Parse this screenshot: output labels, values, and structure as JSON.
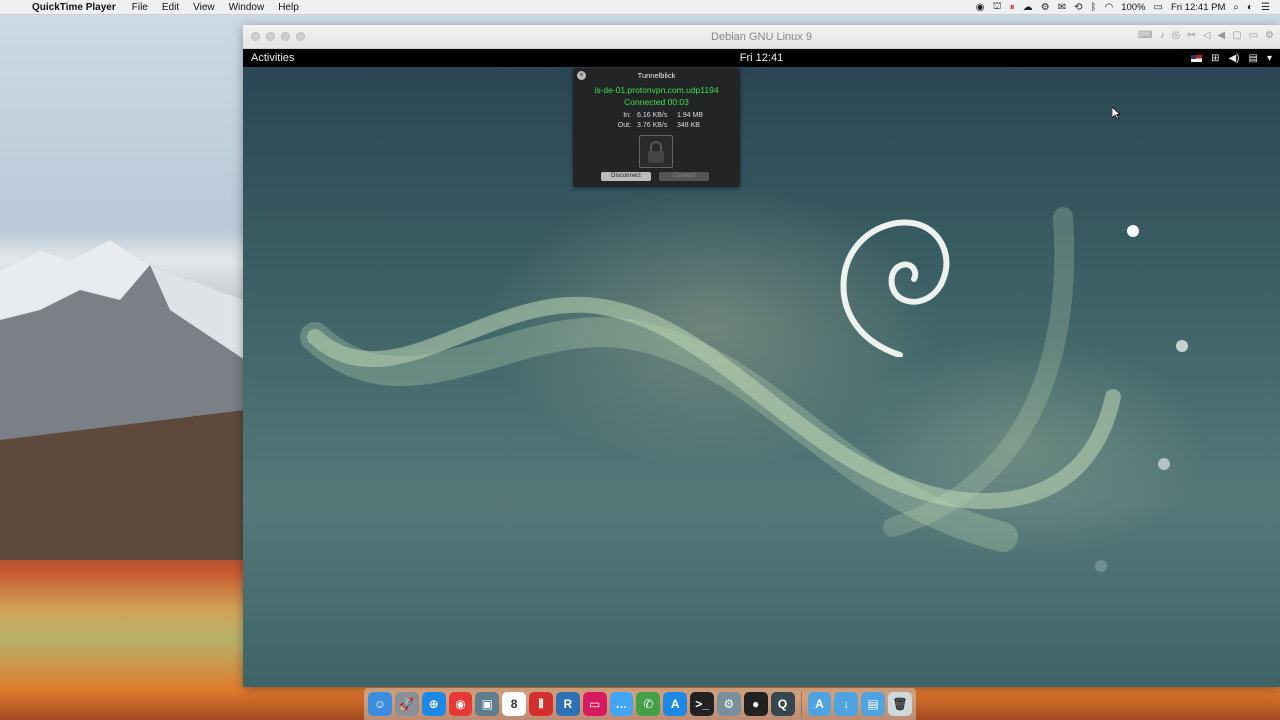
{
  "macos": {
    "menubar": {
      "apple_glyph": "",
      "app_name": "QuickTime Player",
      "menus": [
        "File",
        "Edit",
        "View",
        "Window",
        "Help"
      ],
      "battery": "100%",
      "clock": "Fri 12:41 PM"
    }
  },
  "vm_window": {
    "title": "Debian GNU Linux 9",
    "gnome": {
      "activities": "Activities",
      "clock": "Fri 12:41"
    }
  },
  "tunnelblick": {
    "title": "Tunnelblick",
    "server": "is-de-01.protonvpn.com.udp1194",
    "status": "Connected 00:03",
    "in_label": "In:",
    "in_rate": "6.16 KB/s",
    "in_total": "1.94 MB",
    "out_label": "Out:",
    "out_rate": "3.76 KB/s",
    "out_total": "348 KB",
    "disconnect_label": "Disconnect",
    "connect_label": "Connect"
  },
  "dock": {
    "apps": [
      {
        "name": "finder",
        "glyph": "☺",
        "color": "#3b8de0"
      },
      {
        "name": "launchpad",
        "glyph": "🚀",
        "color": "#8a8f98"
      },
      {
        "name": "safari",
        "glyph": "⊕",
        "color": "#1e88e5"
      },
      {
        "name": "chrome",
        "glyph": "◉",
        "color": "#e53935"
      },
      {
        "name": "preview",
        "glyph": "▣",
        "color": "#607d8b"
      },
      {
        "name": "calendar",
        "glyph": "8",
        "color": "#ffffff"
      },
      {
        "name": "parallels",
        "glyph": "⫴",
        "color": "#d32f2f"
      },
      {
        "name": "r-app",
        "glyph": "R",
        "color": "#2f6fb3"
      },
      {
        "name": "photo-booth",
        "glyph": "▭",
        "color": "#d81b60"
      },
      {
        "name": "messages",
        "glyph": "…",
        "color": "#42a5f5"
      },
      {
        "name": "facetime",
        "glyph": "✆",
        "color": "#43a047"
      },
      {
        "name": "app-store",
        "glyph": "A",
        "color": "#1e88e5"
      },
      {
        "name": "terminal",
        "glyph": ">_",
        "color": "#222222"
      },
      {
        "name": "system-preferences",
        "glyph": "⚙",
        "color": "#78909c"
      },
      {
        "name": "screen-recorder",
        "glyph": "●",
        "color": "#222222"
      },
      {
        "name": "quicktime",
        "glyph": "Q",
        "color": "#37474f"
      },
      {
        "name": "applications-folder",
        "glyph": "A",
        "color": "#4fa3e0"
      },
      {
        "name": "downloads-folder",
        "glyph": "↓",
        "color": "#4fa3e0"
      },
      {
        "name": "documents-folder",
        "glyph": "▤",
        "color": "#4fa3e0"
      },
      {
        "name": "trash",
        "glyph": "🗑",
        "color": "#cfd8dc"
      }
    ]
  }
}
